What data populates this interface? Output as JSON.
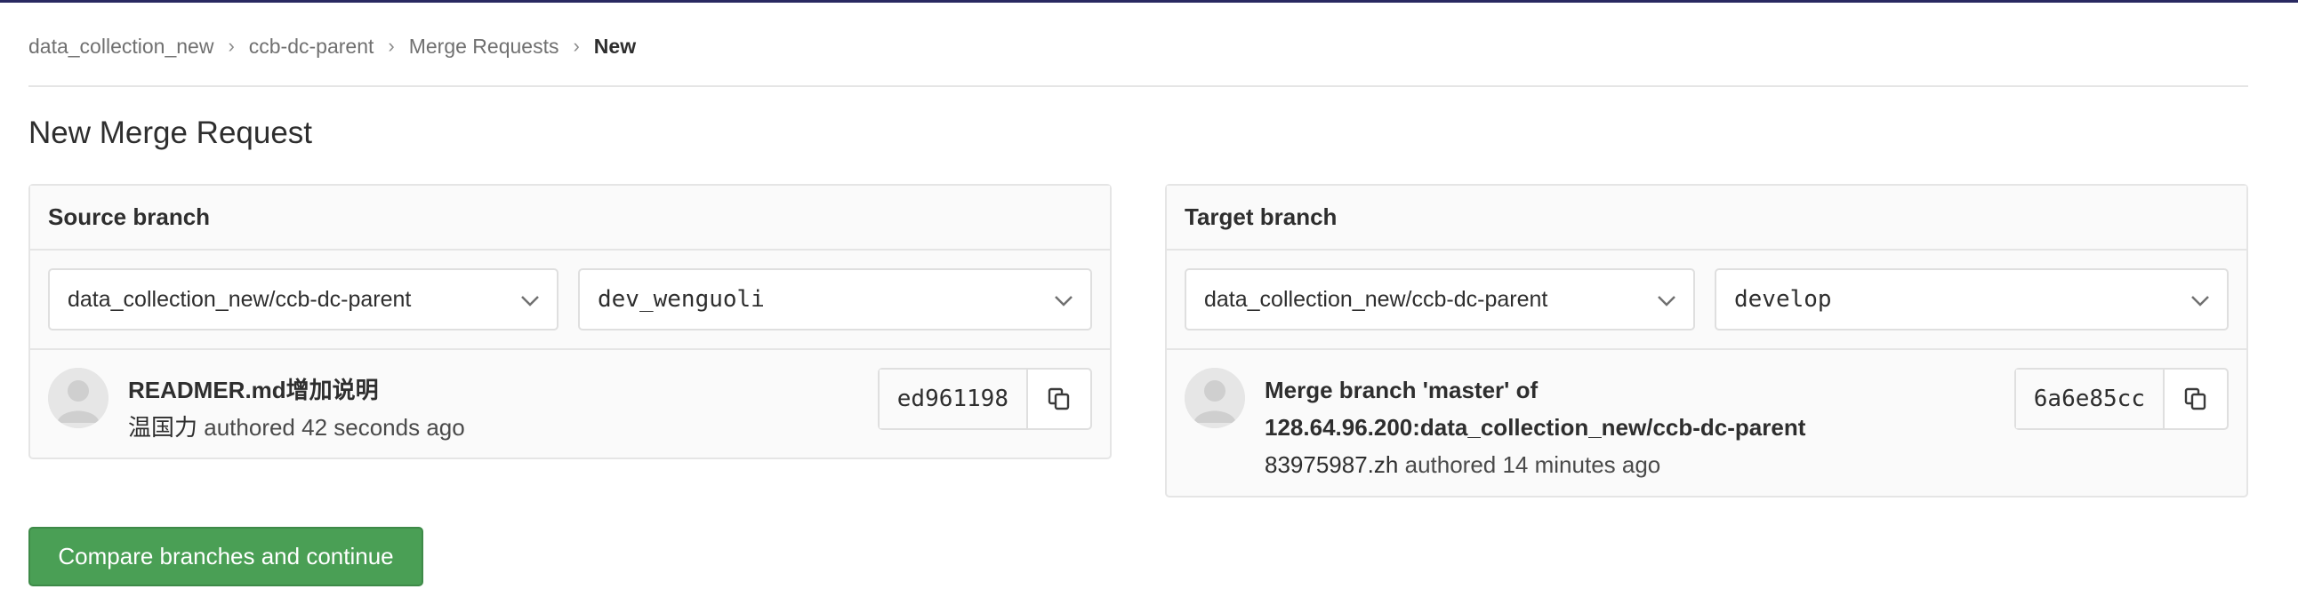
{
  "breadcrumbs": {
    "items": [
      "data_collection_new",
      "ccb-dc-parent",
      "Merge Requests",
      "New"
    ]
  },
  "page": {
    "title": "New Merge Request"
  },
  "source": {
    "header": "Source branch",
    "project": "data_collection_new/ccb-dc-parent",
    "branch": "dev_wenguoli",
    "commit": {
      "title": "READMER.md增加说明",
      "author": "温国力",
      "meta_suffix": "authored 42 seconds ago",
      "sha": "ed961198"
    }
  },
  "target": {
    "header": "Target branch",
    "project": "data_collection_new/ccb-dc-parent",
    "branch": "develop",
    "commit": {
      "title_line1": "Merge branch 'master' of",
      "title_line2": "128.64.96.200:data_collection_new/ccb-dc-parent",
      "author": "83975987.zh",
      "meta_suffix": "authored 14 minutes ago",
      "sha": "6a6e85cc"
    }
  },
  "actions": {
    "compare_label": "Compare branches and continue"
  },
  "colors": {
    "primary_green": "#4a9f55",
    "top_bar": "#292961",
    "border": "#e5e5e5"
  },
  "icons": [
    "chevron-right-icon",
    "chevron-down-icon",
    "avatar-placeholder-icon",
    "copy-icon"
  ]
}
